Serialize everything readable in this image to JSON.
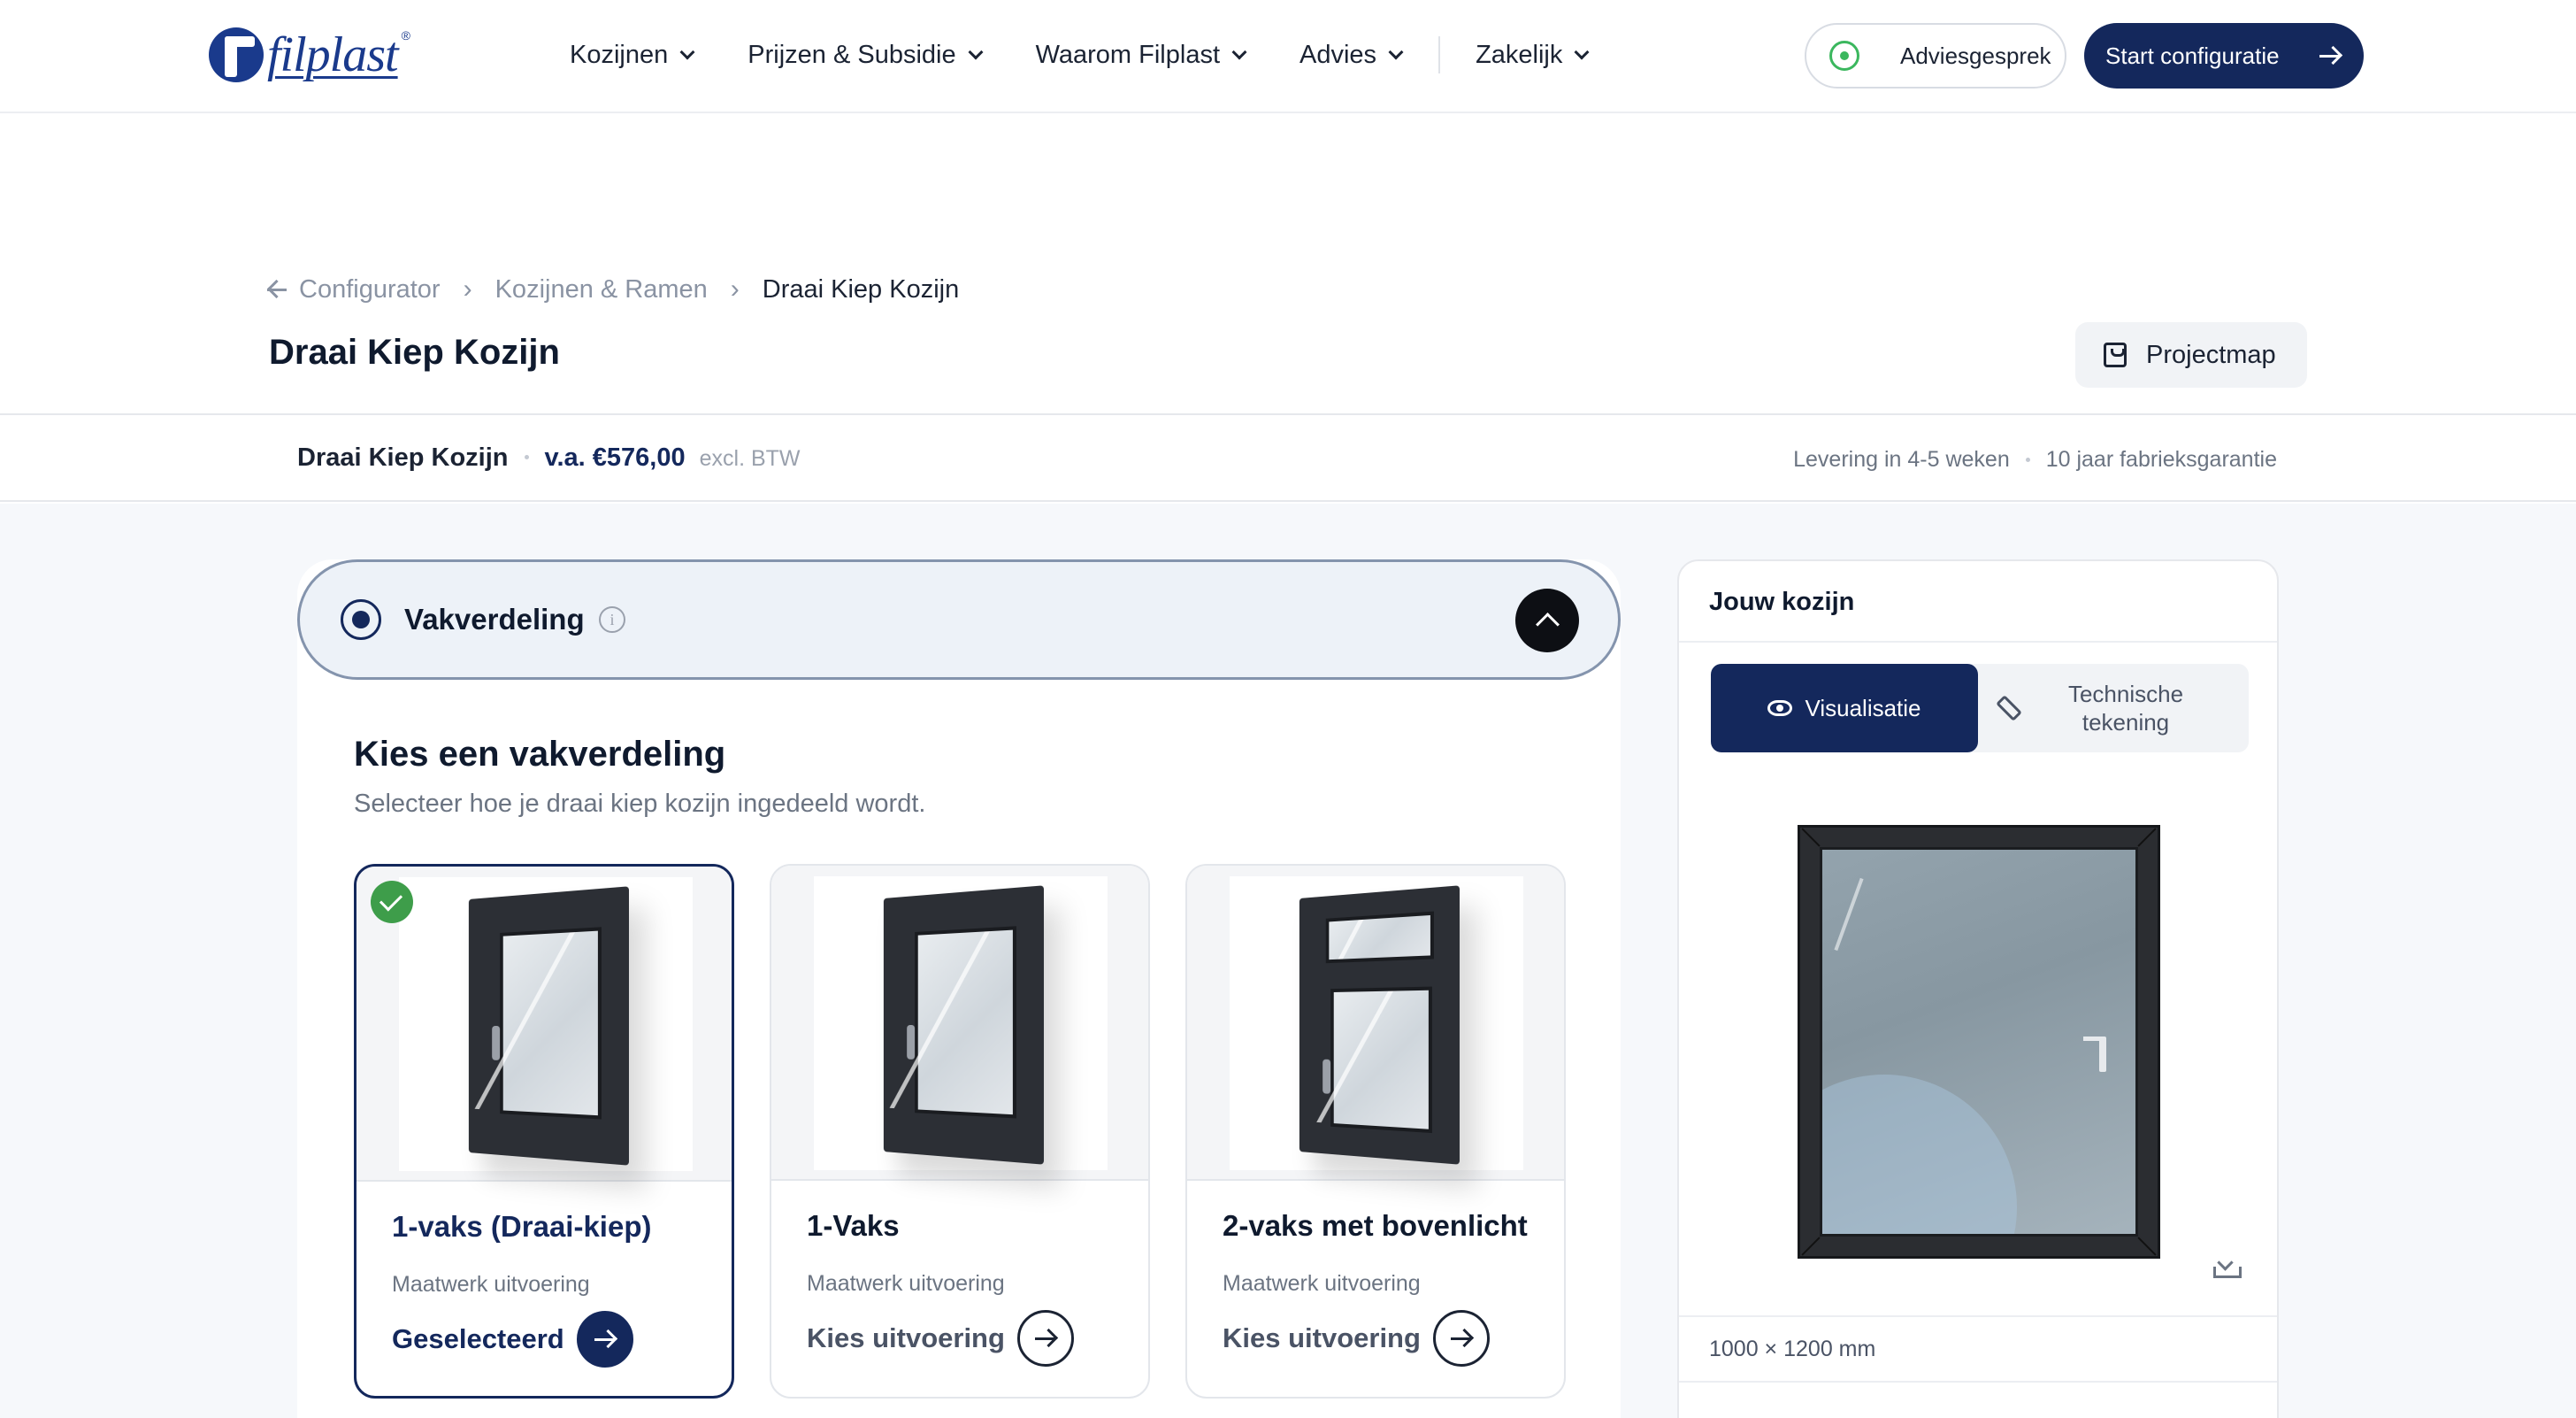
{
  "brand": {
    "logo_text": "filplast",
    "logo_reg": "®"
  },
  "nav": {
    "items": [
      {
        "label": "Kozijnen"
      },
      {
        "label": "Prijzen & Subsidie"
      },
      {
        "label": "Waarom Filplast"
      },
      {
        "label": "Advies"
      },
      {
        "label": "Zakelijk"
      }
    ],
    "advies_button": "Adviesgesprek",
    "start_button": "Start configuratie"
  },
  "breadcrumb": {
    "back": "Configurator",
    "middle": "Kozijnen & Ramen",
    "current": "Draai Kiep Kozijn"
  },
  "page": {
    "title": "Draai Kiep Kozijn",
    "projectmap_button": "Projectmap"
  },
  "summary": {
    "product": "Draai Kiep Kozijn",
    "price": "v.a. €576,00",
    "btw": "excl. BTW",
    "delivery": "Levering in 4-5 weken",
    "warranty": "10 jaar fabrieksgarantie"
  },
  "step": {
    "title": "Vakverdeling",
    "info_glyph": "i",
    "section_title": "Kies een vakverdeling",
    "section_subtitle": "Selecteer hoe je draai kiep kozijn ingedeeld wordt.",
    "options": [
      {
        "name": "1-vaks (Draai-kiep)",
        "desc": "Maatwerk uitvoering",
        "cta": "Geselecteerd",
        "selected": true
      },
      {
        "name": "1-Vaks",
        "desc": "Maatwerk uitvoering",
        "cta": "Kies uitvoering",
        "selected": false
      },
      {
        "name": "2-vaks met bovenlicht",
        "desc": "Maatwerk uitvoering",
        "cta": "Kies uitvoering",
        "selected": false
      }
    ]
  },
  "preview": {
    "title": "Jouw kozijn",
    "tab_visual": "Visualisatie",
    "tab_technical": "Technische tekening",
    "dimensions": "1000 × 1200 mm"
  },
  "colors": {
    "primary": "#14285c",
    "brand_blue": "#1a3a8c",
    "success": "#3e9d4a",
    "whatsapp": "#3bb75e"
  },
  "icons": {
    "logo": "filplast-logo",
    "menu_chevron": "chevron-down-icon",
    "whatsapp": "whatsapp-icon",
    "start_arrow": "arrow-right-icon",
    "back_arrow": "arrow-left-icon",
    "projectmap": "shopping-bag-icon",
    "step_radio": "radio-selected-icon",
    "info": "info-icon",
    "collapse": "chevron-up-icon",
    "check": "check-icon",
    "visual_tab": "eye-icon",
    "technical_tab": "ruler-icon",
    "download": "download-icon"
  }
}
